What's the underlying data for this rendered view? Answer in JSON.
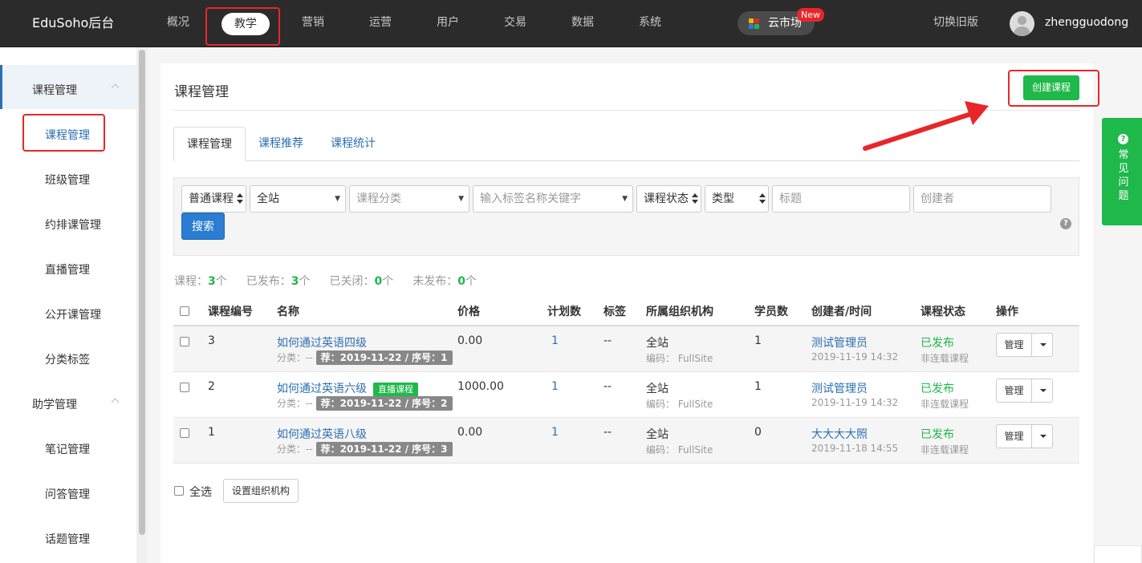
{
  "topbar": {
    "brand": "EduSoho后台",
    "nav": [
      "概况",
      "教学",
      "营销",
      "运营",
      "用户",
      "交易",
      "数据",
      "系统"
    ],
    "active_nav": "教学",
    "cloud_market": "云市场",
    "new_badge": "New",
    "switch_old": "切换旧版",
    "username": "zhengguodong"
  },
  "sidebar": {
    "groups": [
      {
        "label": "课程管理",
        "items": [
          "课程管理",
          "班级管理",
          "约排课管理",
          "直播管理",
          "公开课管理",
          "分类标签"
        ]
      },
      {
        "label": "助学管理",
        "items": [
          "笔记管理",
          "问答管理",
          "话题管理"
        ]
      }
    ],
    "active_item": "课程管理"
  },
  "main": {
    "title": "课程管理",
    "create_button": "创建课程",
    "tabs": [
      "课程管理",
      "课程推荐",
      "课程统计"
    ],
    "filters": {
      "course_type": "普通课程",
      "site": "全站",
      "category_placeholder": "课程分类",
      "tag_placeholder": "输入标签名称关键字",
      "status": "课程状态",
      "kind": "类型",
      "title_placeholder": "标题",
      "creator_placeholder": "创建者",
      "search_button": "搜索",
      "help_icon": "?"
    },
    "stats": {
      "course_label": "课程：",
      "course_count": "3",
      "published_label": "已发布：",
      "published_count": "3",
      "closed_label": "已关闭：",
      "closed_count": "0",
      "unpublished_label": "未发布：",
      "unpublished_count": "0",
      "unit": "个"
    },
    "table": {
      "headers": [
        "课程编号",
        "名称",
        "价格",
        "计划数",
        "标签",
        "所属组织机构",
        "学员数",
        "创建者/时间",
        "课程状态",
        "操作"
      ],
      "rows": [
        {
          "id": "3",
          "name": "如何通过英语四级",
          "live_tag": "",
          "category": "分类：--",
          "recommend": "荐：2019-11-22 / 序号：1",
          "price": "0.00",
          "plans": "1",
          "tags": "--",
          "org": "全站",
          "org_code": "编码： FullSite",
          "students": "1",
          "creator": "测试管理员",
          "created_at": "2019-11-19 14:32",
          "status": "已发布",
          "serial": "非连载课程",
          "action": "管理"
        },
        {
          "id": "2",
          "name": "如何通过英语六级",
          "live_tag": "直播课程",
          "category": "分类：--",
          "recommend": "荐：2019-11-22 / 序号：2",
          "price": "1000.00",
          "plans": "1",
          "tags": "--",
          "org": "全站",
          "org_code": "编码： FullSite",
          "students": "1",
          "creator": "测试管理员",
          "created_at": "2019-11-19 14:32",
          "status": "已发布",
          "serial": "非连载课程",
          "action": "管理"
        },
        {
          "id": "1",
          "name": "如何通过英语八级",
          "live_tag": "",
          "category": "分类：--",
          "recommend": "荐：2019-11-22 / 序号：3",
          "price": "0.00",
          "plans": "1",
          "tags": "--",
          "org": "全站",
          "org_code": "编码： FullSite",
          "students": "0",
          "creator": "大大大大照",
          "created_at": "2019-11-18 14:55",
          "status": "已发布",
          "serial": "非连载课程",
          "action": "管理"
        }
      ]
    },
    "footer": {
      "select_all": "全选",
      "set_org_button": "设置组织机构"
    }
  },
  "faq_tab": {
    "icon": "?",
    "label": "常见问题"
  },
  "colors": {
    "topbar_bg": "#2b2b2b",
    "accent_green": "#1fb84a",
    "link_blue": "#2a6fb3",
    "annotation_red": "#e8262a"
  }
}
